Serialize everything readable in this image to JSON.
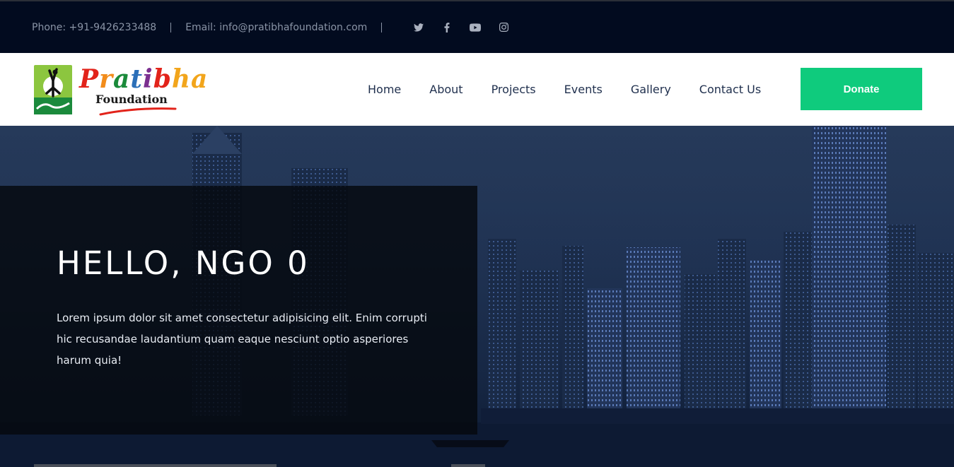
{
  "topbar": {
    "phone": "Phone: +91-9426233488",
    "email": "Email: info@pratibhafoundation.com",
    "socials": [
      "twitter-icon",
      "facebook-icon",
      "youtube-icon",
      "instagram-icon"
    ]
  },
  "header": {
    "logo": {
      "wordmark": "Pratibha",
      "subtitle": "Foundation"
    },
    "nav": [
      "Home",
      "About",
      "Projects",
      "Events",
      "Gallery",
      "Contact Us"
    ],
    "donate_label": "Donate"
  },
  "hero": {
    "title": "HELLO, NGO 0",
    "text": "Lorem ipsum dolor sit amet consectetur adipisicing elit. Enim corrupti hic recusandae laudantium quam eaque nesciunt optio asperiores harum quia!"
  },
  "colors": {
    "topbar_bg": "#020b1f",
    "accent": "#0fcb7d",
    "nav_text": "#1f2f4d"
  }
}
